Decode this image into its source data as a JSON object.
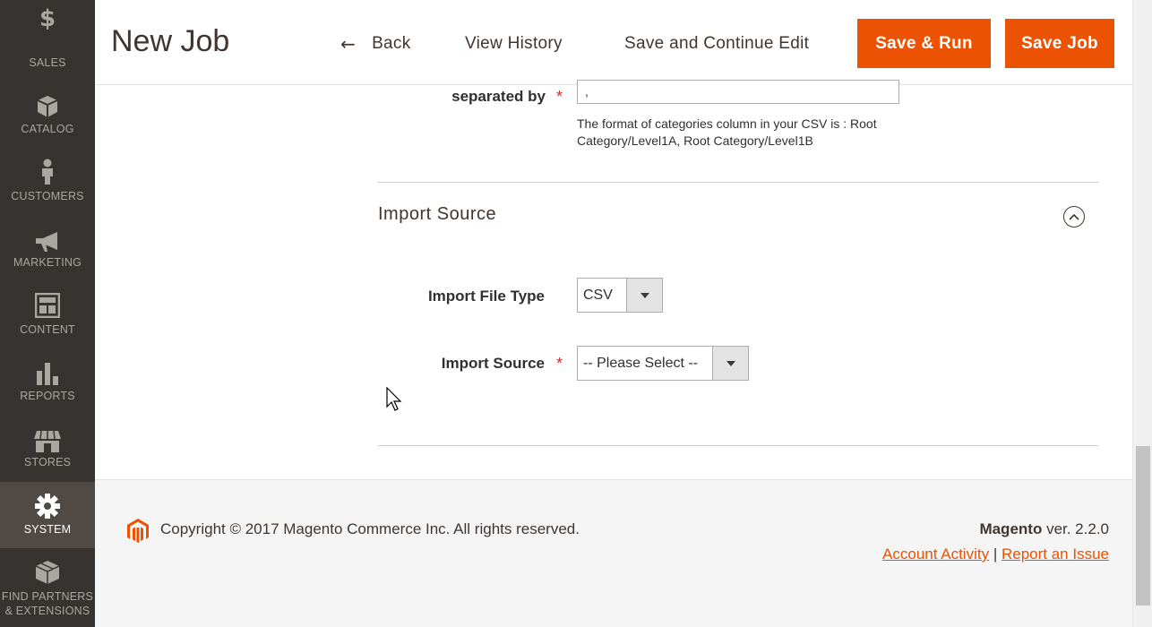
{
  "sidebar": {
    "items": [
      {
        "label": "SALES",
        "icon": "dollar-icon"
      },
      {
        "label": "CATALOG",
        "icon": "box-icon"
      },
      {
        "label": "CUSTOMERS",
        "icon": "person-icon"
      },
      {
        "label": "MARKETING",
        "icon": "megaphone-icon"
      },
      {
        "label": "CONTENT",
        "icon": "layout-icon"
      },
      {
        "label": "REPORTS",
        "icon": "bar-chart-icon"
      },
      {
        "label": "STORES",
        "icon": "storefront-icon"
      },
      {
        "label": "SYSTEM",
        "icon": "gear-icon",
        "active": true
      },
      {
        "label_line1": "FIND PARTNERS",
        "label_line2": "& EXTENSIONS",
        "icon": "blocks-icon"
      }
    ],
    "dollar_glyph": "$"
  },
  "header": {
    "title": "New Job",
    "back_label": "Back",
    "history_label": "View History",
    "save_continue_label": "Save and Continue Edit",
    "save_run_label": "Save & Run",
    "save_job_label": "Save Job"
  },
  "form": {
    "separator_label": "separated by",
    "separator_value": ",",
    "separator_note_line1": "The format of categories column in your CSV is : Root",
    "separator_note_line2": "Category/Level1A, Root Category/Level1B",
    "required_mark": "*",
    "section_title": "Import Source",
    "file_type_label": "Import File Type",
    "file_type_value": "CSV",
    "source_label": "Import Source",
    "source_value": "-- Please Select --"
  },
  "footer": {
    "copyright": "Copyright © 2017 Magento Commerce Inc. All rights reserved.",
    "brand": "Magento",
    "version": "ver. 2.2.0",
    "account_activity": "Account Activity",
    "separator": "|",
    "report_issue": "Report an Issue"
  },
  "colors": {
    "accent": "#eb5202",
    "sidebar_bg": "#373330",
    "sidebar_active": "#514943"
  }
}
